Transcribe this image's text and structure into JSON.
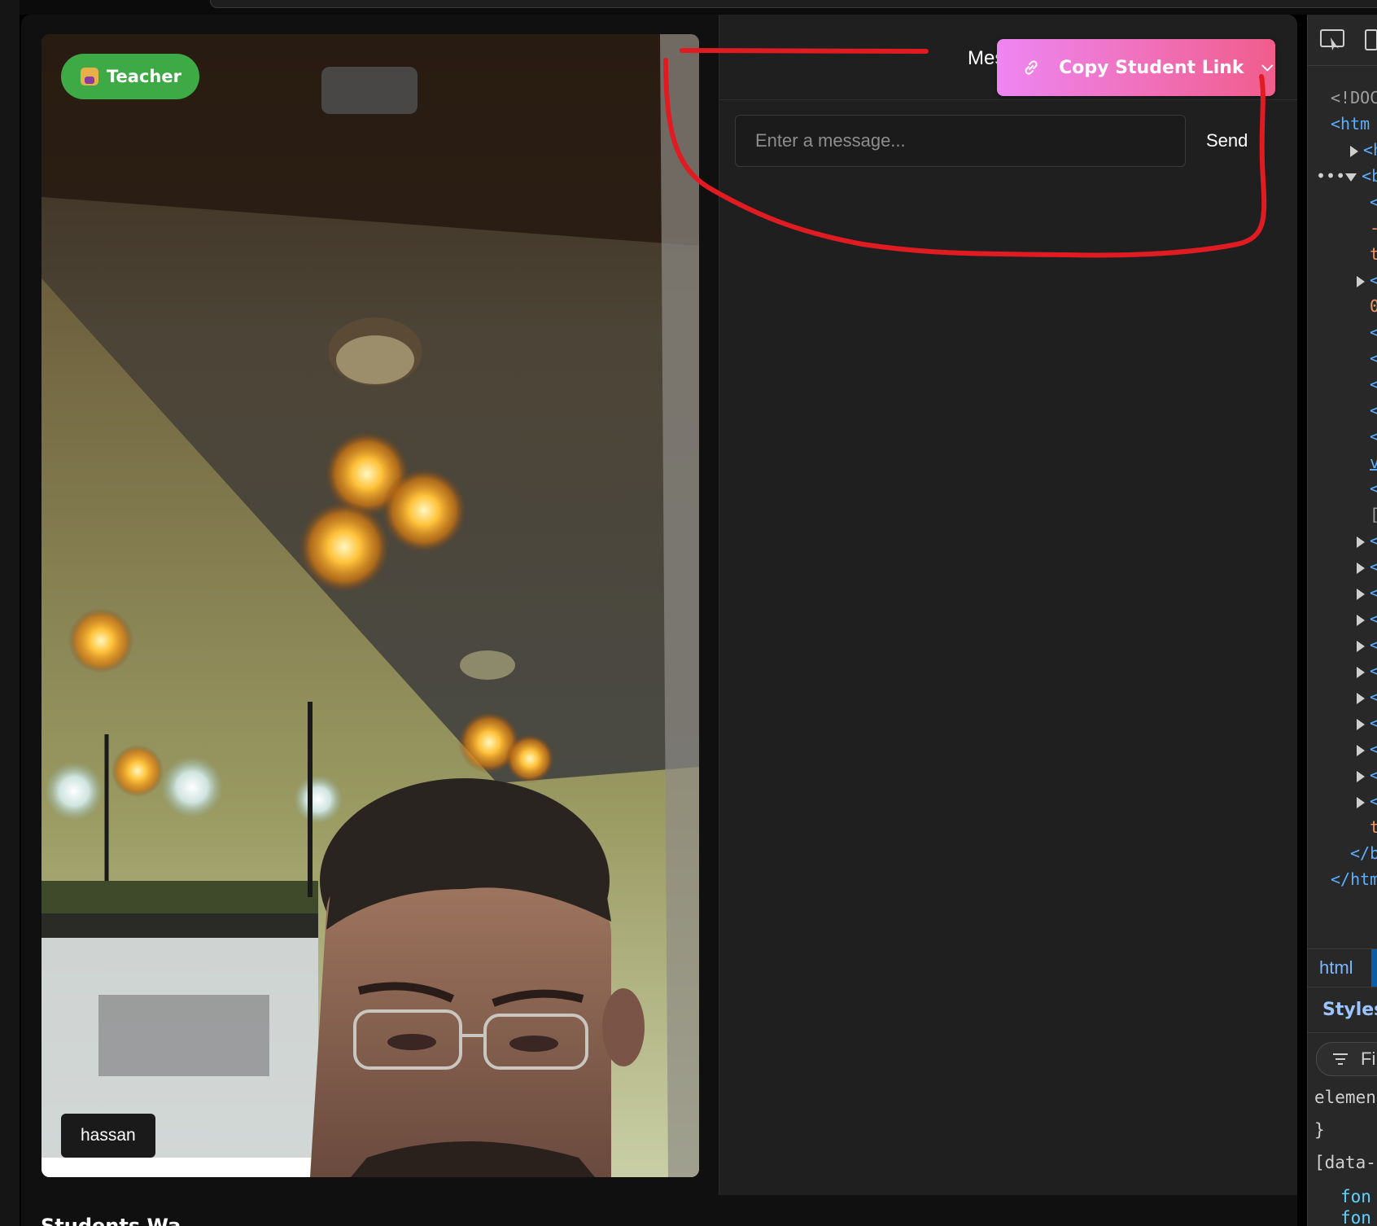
{
  "video": {
    "role_badge": "Teacher",
    "participant_name": "hassan"
  },
  "chat": {
    "tab_label": "Mes",
    "copy_link_button": "Copy Student Link",
    "message_placeholder": "Enter a message...",
    "send_label": "Send"
  },
  "below_video_text": "Students Wa",
  "devtools": {
    "tree": [
      {
        "text": "<!DOC",
        "style": "gray"
      },
      {
        "text": "<htm",
        "style": "tag"
      },
      {
        "text": "<he",
        "style": "tag"
      },
      {
        "text": "<bo",
        "style": "tag"
      },
      {
        "text": "<",
        "style": "tag"
      },
      {
        "text": "-",
        "style": "orange"
      },
      {
        "text": "t",
        "style": "orange"
      },
      {
        "text": "<",
        "style": "tag"
      },
      {
        "text": "0",
        "style": "orange"
      },
      {
        "text": "<",
        "style": "tag"
      },
      {
        "text": "<",
        "style": "tag"
      },
      {
        "text": "<",
        "style": "tag"
      },
      {
        "text": "<",
        "style": "tag"
      },
      {
        "text": "<",
        "style": "tag"
      },
      {
        "text": "v",
        "style": "tag"
      },
      {
        "text": "<",
        "style": "tag"
      },
      {
        "text": "[",
        "style": "gray"
      },
      {
        "text": "<",
        "style": "tag"
      },
      {
        "text": "<",
        "style": "tag"
      },
      {
        "text": "<",
        "style": "tag"
      },
      {
        "text": "<",
        "style": "tag"
      },
      {
        "text": "<",
        "style": "tag"
      },
      {
        "text": "<",
        "style": "tag"
      },
      {
        "text": "<",
        "style": "tag"
      },
      {
        "text": "<",
        "style": "tag"
      },
      {
        "text": "<",
        "style": "tag"
      },
      {
        "text": "<",
        "style": "tag"
      },
      {
        "text": "<",
        "style": "tag"
      },
      {
        "text": "t",
        "style": "orange"
      },
      {
        "text": "</b",
        "style": "tag"
      },
      {
        "text": "</htm",
        "style": "tag"
      }
    ],
    "breadcrumb": "html",
    "styles_tab": "Styles",
    "filter_placeholder": "Fi",
    "styles_lines": [
      "elemen",
      "}",
      "[data-",
      "fon",
      "fon"
    ]
  }
}
